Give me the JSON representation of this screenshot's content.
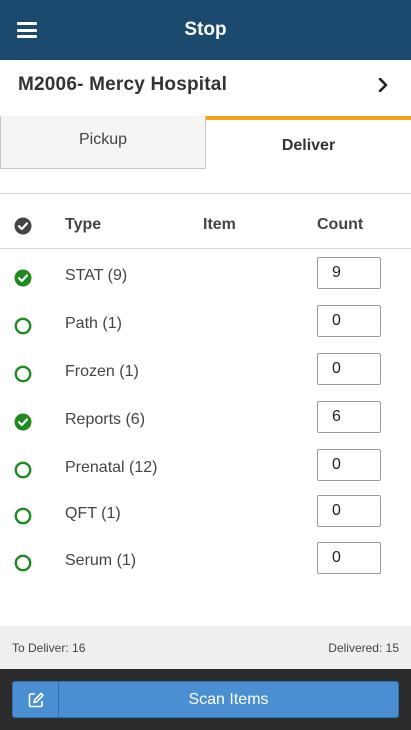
{
  "header": {
    "title": "Stop",
    "menu_icon": "hamburger-menu-icon"
  },
  "location": {
    "name": "M2006- Mercy Hospital",
    "chevron_icon": "chevron-right-icon"
  },
  "tabs": [
    {
      "label": "Pickup",
      "active": false
    },
    {
      "label": "Deliver",
      "active": true
    }
  ],
  "table": {
    "headers": {
      "type": "Type",
      "item": "Item",
      "count": "Count"
    },
    "rows": [
      {
        "type": "STAT (9)",
        "count": "9",
        "checked": true
      },
      {
        "type": "Path (1)",
        "count": "0",
        "checked": false
      },
      {
        "type": "Frozen (1)",
        "count": "0",
        "checked": false
      },
      {
        "type": "Reports (6)",
        "count": "6",
        "checked": true
      },
      {
        "type": "Prenatal (12)",
        "count": "0",
        "checked": false
      },
      {
        "type": "QFT (1)",
        "count": "0",
        "checked": false
      },
      {
        "type": "Serum (1)",
        "count": "0",
        "checked": false
      }
    ]
  },
  "summary": {
    "to_deliver": "To Deliver: 16",
    "delivered": "Delivered: 15"
  },
  "action": {
    "scan_label": "Scan Items",
    "icon": "edit-icon"
  },
  "colors": {
    "header_bg": "#1b4a6e",
    "tab_accent": "#f4a11a",
    "check_green": "#1f8a1f",
    "scan_button": "#4a8fd1"
  }
}
